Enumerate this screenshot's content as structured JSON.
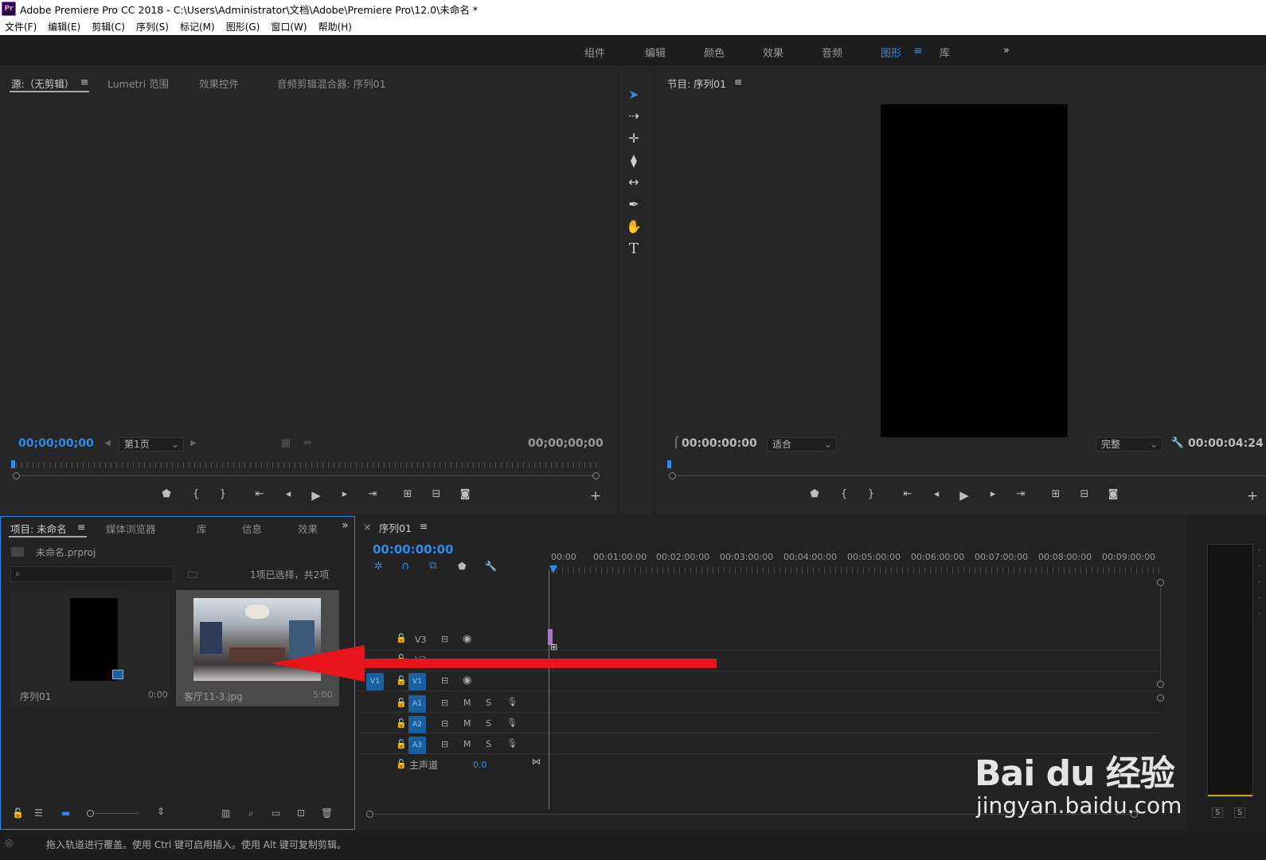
{
  "title_bar": {
    "app_label": "Pr",
    "title": "Adobe Premiere Pro CC 2018 - C:\\Users\\Administrator\\文档\\Adobe\\Premiere Pro\\12.0\\未命名 *"
  },
  "menu": [
    "文件(F)",
    "编辑(E)",
    "剪辑(C)",
    "序列(S)",
    "标记(M)",
    "图形(G)",
    "窗口(W)",
    "帮助(H)"
  ],
  "workspaces": {
    "items": [
      "组件",
      "编辑",
      "颜色",
      "效果",
      "音频",
      "图形",
      "库"
    ],
    "active": "图形",
    "more": "»"
  },
  "source_panel": {
    "tabs": [
      "源:（无剪辑）",
      "Lumetri 范围",
      "效果控件",
      "音频剪辑混合器: 序列01"
    ],
    "timecode_left": "00;00;00;00",
    "page": "第1页",
    "timecode_right": "00;00;00;00",
    "add": "+"
  },
  "tools": [
    "selection-tool",
    "track-select-tool",
    "ripple-edit-tool",
    "razor-tool",
    "slip-tool",
    "pen-tool",
    "hand-tool",
    "type-tool"
  ],
  "program_panel": {
    "tab": "节目: 序列01",
    "timecode_left": "00:00:00:00",
    "fit": "适合",
    "quality": "完整",
    "timecode_right": "00:00:04:24",
    "add": "+"
  },
  "project_panel": {
    "tabs": [
      "项目: 未命名",
      "媒体浏览器",
      "库",
      "信息",
      "效果"
    ],
    "file": "未命名.prproj",
    "search_placeholder": "",
    "selection_info": "1项已选择，共2项",
    "items": [
      {
        "name": "序列01",
        "duration": "0:00"
      },
      {
        "name": "客厅11-3.jpg",
        "duration": "5:00"
      }
    ]
  },
  "timeline": {
    "tab": "序列01",
    "close": "×",
    "timecode": "00:00:00:00",
    "ruler_labels": [
      "00:00",
      "00:01:00:00",
      "00:02:00:00",
      "00:03:00:00",
      "00:04:00:00",
      "00:05:00:00",
      "00:06:00:00",
      "00:07:00:00",
      "00:08:00:00",
      "00:09:00:00"
    ],
    "video_tracks": [
      "V3",
      "V2",
      "V1"
    ],
    "source_patch": "V1",
    "audio_tracks": [
      "A1",
      "A2",
      "A3"
    ],
    "mute": "M",
    "solo": "S",
    "master_label": "主声道",
    "master_value": "0.0"
  },
  "audio_meter": {
    "solo_left": "S",
    "solo_right": "S"
  },
  "watermark": {
    "brand": "Bai du 经验",
    "url": "jingyan.baidu.com"
  },
  "status_bar": "拖入轨道进行覆盖。使用 Ctrl 键可启用插入。使用 Alt 键可复制剪辑。",
  "colors": {
    "accent": "#2d8ceb",
    "arrow": "#e8141b",
    "panel_bg": "#232323",
    "track_blue": "#1a5fa0"
  }
}
